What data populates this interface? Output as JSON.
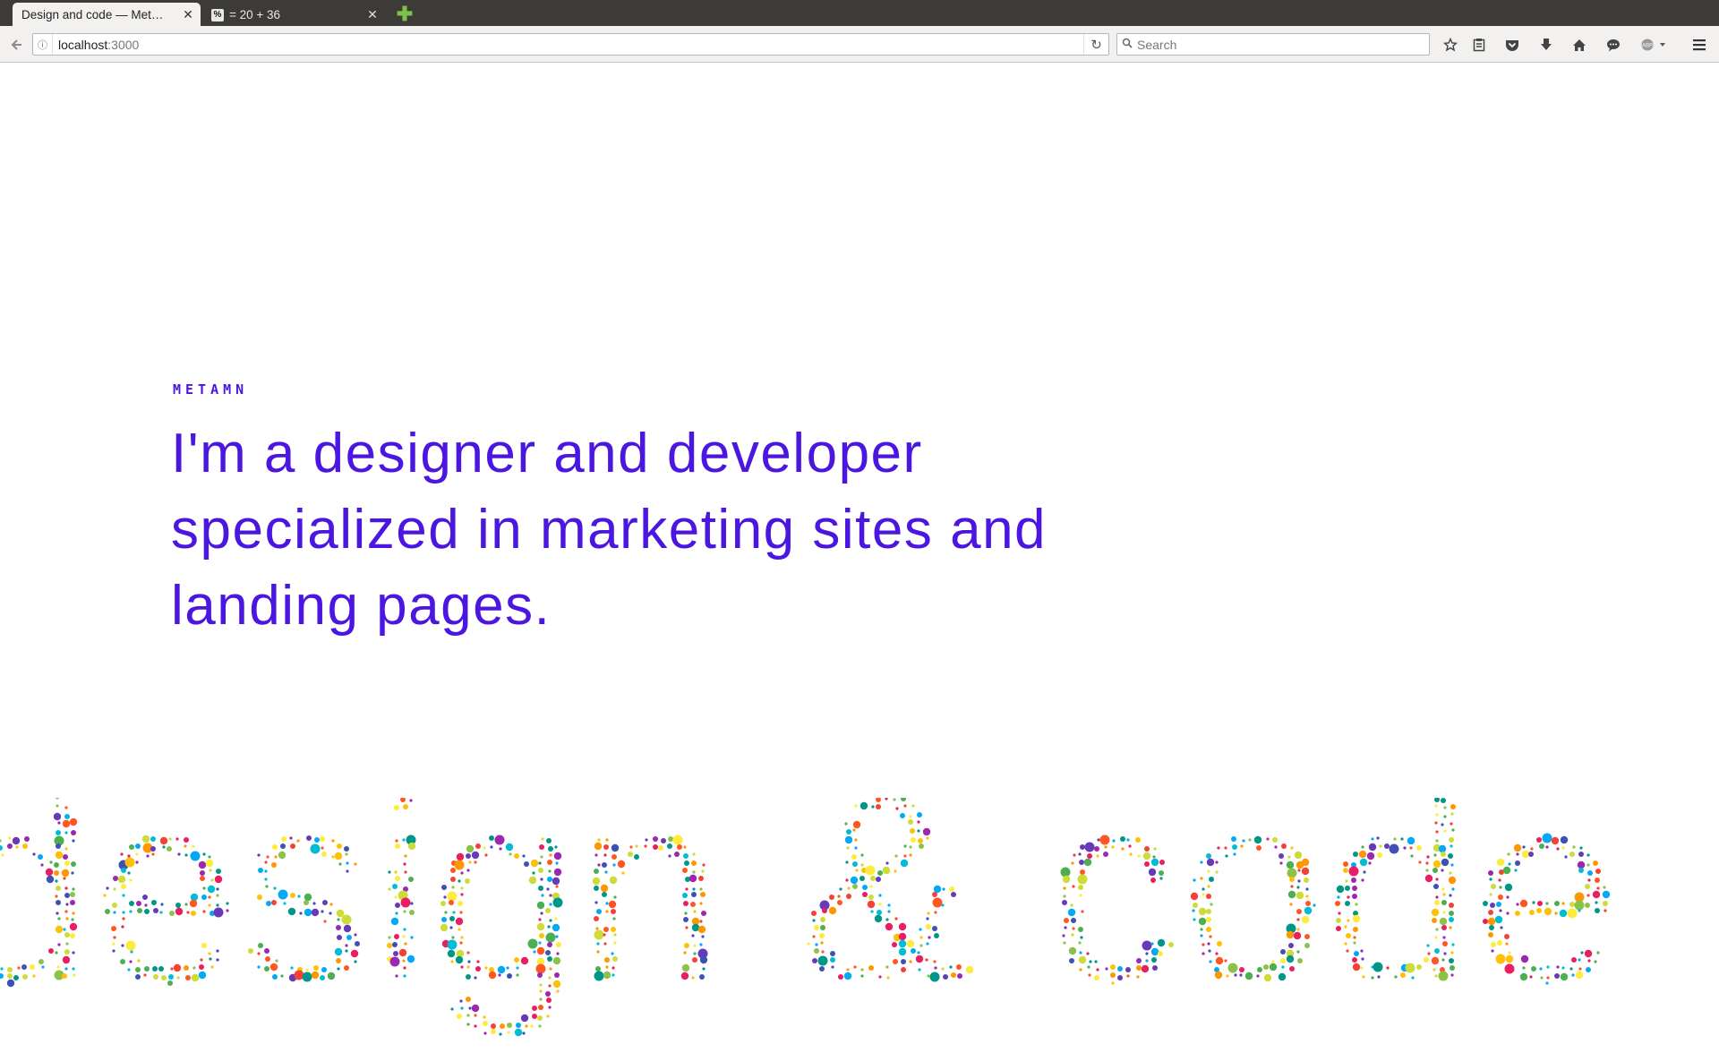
{
  "browser": {
    "tabs": [
      {
        "title": "Design and code — Met…",
        "active": true
      },
      {
        "title": "= 20 + 36",
        "favicon": "%",
        "active": false
      }
    ],
    "url_host": "localhost",
    "url_port": ":3000",
    "search_placeholder": "Search",
    "icons": {
      "back": "back-arrow-icon",
      "info": "info-icon",
      "reload": "reload-icon",
      "search": "search-icon",
      "bookmark": "star-icon",
      "reading_list": "clipboard-icon",
      "pocket": "pocket-icon",
      "download": "download-icon",
      "home": "home-icon",
      "chat": "chat-icon",
      "adblock": "abp-icon",
      "menu": "hamburger-menu-icon"
    },
    "new_tab_color": "#7fc24b"
  },
  "page": {
    "brand": "METAMN",
    "headline": "I'm a designer and developer specialized in marketing sites and landing pages.",
    "accent_color": "#4b16e0",
    "dot_art_text": "design & code",
    "dot_colors": [
      "#e91e63",
      "#9c27b0",
      "#673ab7",
      "#3f51b5",
      "#03a9f4",
      "#00bcd4",
      "#009688",
      "#4caf50",
      "#8bc34a",
      "#cddc39",
      "#ffeb3b",
      "#ffc107",
      "#ff9800",
      "#ff5722",
      "#f44336"
    ]
  }
}
